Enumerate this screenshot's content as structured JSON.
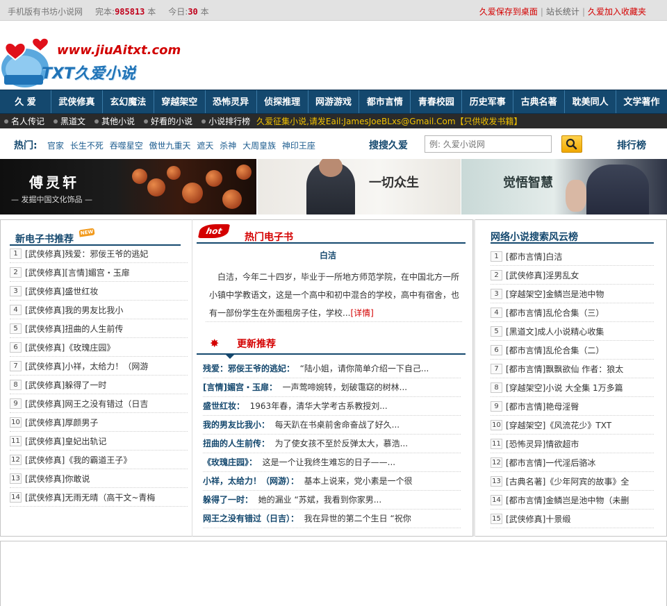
{
  "topbar": {
    "site_label": "手机版有书坊小说网",
    "total_label": "完本:",
    "total_value": "985813",
    "total_unit": "本",
    "today_label": "今日:",
    "today_value": "30",
    "today_unit": "本",
    "link_save": "久爱保存到桌面",
    "sep": "|",
    "link_stats": "站长统计",
    "link_fav": "久爱加入收藏夹"
  },
  "logo": {
    "site_url": "www.jiuAitxt.com",
    "brand": "TXT久爱小说"
  },
  "main_nav": [
    "久 爱",
    "武侠修真",
    "玄幻魔法",
    "穿越架空",
    "恐怖灵异",
    "侦探推理",
    "网游游戏",
    "都市言情",
    "青春校园",
    "历史军事",
    "古典名著",
    "耽美同人",
    "文学著作"
  ],
  "sub_nav": {
    "items": [
      "名人传记",
      "黑道文",
      "其他小说",
      "好看的小说",
      "小说排行榜"
    ],
    "notice": "久爱征集小说,请发Eail:JamesJoeBLxs@Gmail.Com【只供收发书籍】"
  },
  "search_row": {
    "hot_label": "热门:",
    "hot_links": [
      "官家",
      "长生不死",
      "吞噬星空",
      "傲世九重天",
      "遮天",
      "杀神",
      "大周皇族",
      "神印王座"
    ],
    "search_title": "搜搜久爱",
    "search_placeholder": "例: 久爱小说网",
    "search_icon": "magnifier-icon",
    "rank_label": "排行榜"
  },
  "banners": {
    "b1_title": "傅灵轩",
    "b1_sub": "— 发掘中国文化饰品 —",
    "b2_title": "一切众生",
    "b3_title": "觉悟智慧"
  },
  "left_col": {
    "title": "新电子书推荐",
    "new_tag": "NEW",
    "items": [
      {
        "n": "1",
        "cat": "[武侠修真]",
        "title": "残爱：邪佞王爷的逃妃"
      },
      {
        "n": "2",
        "cat": "[武侠修真]",
        "title": "[言情]媚宫・玉扉"
      },
      {
        "n": "3",
        "cat": "[武侠修真]",
        "title": "盛世红妆"
      },
      {
        "n": "4",
        "cat": "[武侠修真]",
        "title": "我的男友比我小"
      },
      {
        "n": "5",
        "cat": "[武侠修真]",
        "title": "扭曲的人生前传"
      },
      {
        "n": "6",
        "cat": "[武侠修真]",
        "title": "《玫瑰庄园》"
      },
      {
        "n": "7",
        "cat": "[武侠修真]",
        "title": "小祥，太给力！（网游"
      },
      {
        "n": "8",
        "cat": "[武侠修真]",
        "title": "躲得了一时"
      },
      {
        "n": "9",
        "cat": "[武侠修真]",
        "title": "网王之没有错过（日吉"
      },
      {
        "n": "10",
        "cat": "[武侠修真]",
        "title": "厚颜男子"
      },
      {
        "n": "11",
        "cat": "[武侠修真]",
        "title": "皇妃出轨记"
      },
      {
        "n": "12",
        "cat": "[武侠修真]",
        "title": "《我的霸道王子》"
      },
      {
        "n": "13",
        "cat": "[武侠修真]",
        "title": "你敢说"
      },
      {
        "n": "14",
        "cat": "[武侠修真]",
        "title": "无雨无晴（高干文~青梅"
      }
    ]
  },
  "mid_col": {
    "hot_badge": "hot",
    "hot_title": "热门电子书",
    "feature_title": "白洁",
    "feature_body": "白洁，今年二十四岁，毕业于一所地方师范学院，在中国北方一所小镇中学教语文，这是一个高中和初中混合的学校，高中有宿舍，也有一部份学生在外面租房子住，学校...",
    "feature_more": "[详情]",
    "update_title": "更新推荐",
    "updates": [
      {
        "t": "残爱：邪佞王爷的逃妃：",
        "d": "“陆小姐，请你简单介绍一下自己..."
      },
      {
        "t": "[言情]媚宫・玉扉：",
        "d": "一声莺啼婉转，划破霭窈的树林..."
      },
      {
        "t": "盛世红妆：",
        "d": "1963年春，清华大学考古系教授刘..."
      },
      {
        "t": "我的男友比我小：",
        "d": "每天趴在书桌前舍命奋战了好久..."
      },
      {
        "t": "扭曲的人生前传：",
        "d": "为了使女孩不至於反弹太大，慕浩..."
      },
      {
        "t": "《玫瑰庄园》：",
        "d": "这是一个让我终生难忘的日子——..."
      },
      {
        "t": "小祥，太给力！（网游）：",
        "d": "基本上说来，党小素是一个很"
      },
      {
        "t": "躲得了一时：",
        "d": "她的漏业  “苏斌，我看到你家男..."
      },
      {
        "t": "网王之没有错过（日吉）：",
        "d": "我在异世的第二个生日  “祝你"
      }
    ]
  },
  "right_col": {
    "title": "网络小说搜索风云榜",
    "items": [
      {
        "n": "1",
        "cat": "[都市言情]",
        "title": "白洁"
      },
      {
        "n": "2",
        "cat": "[武侠修真]",
        "title": "淫男乱女"
      },
      {
        "n": "3",
        "cat": "[穿越架空]",
        "title": "金鳞岂是池中物"
      },
      {
        "n": "4",
        "cat": "[都市言情]",
        "title": "乱伦合集（三）"
      },
      {
        "n": "5",
        "cat": "[黑道文]",
        "title": "成人小说精心收集"
      },
      {
        "n": "6",
        "cat": "[都市言情]",
        "title": "乱伦合集（二）"
      },
      {
        "n": "7",
        "cat": "[都市言情]",
        "title": "飘飘欲仙 作者：狼太"
      },
      {
        "n": "8",
        "cat": "[穿越架空]",
        "title": "小说 大全集 1万多篇"
      },
      {
        "n": "9",
        "cat": "[都市言情]",
        "title": "艳母淫臀"
      },
      {
        "n": "10",
        "cat": "[穿越架空]",
        "title": "《风流花少》TXT"
      },
      {
        "n": "11",
        "cat": "[恐怖灵异]",
        "title": "情欲超市"
      },
      {
        "n": "12",
        "cat": "[都市言情]",
        "title": "一代淫后骆冰"
      },
      {
        "n": "13",
        "cat": "[古典名著]",
        "title": "《少年阿宾的故事》全"
      },
      {
        "n": "14",
        "cat": "[都市言情]",
        "title": "金鳞岂是池中物（未删"
      },
      {
        "n": "15",
        "cat": "[武侠修真]",
        "title": "十景缎"
      }
    ]
  },
  "colors": {
    "nav_bg": "#14486e",
    "accent_red": "#d40000",
    "subnav_bg": "#2a2a2a",
    "notice_yellow": "#f2c200"
  }
}
